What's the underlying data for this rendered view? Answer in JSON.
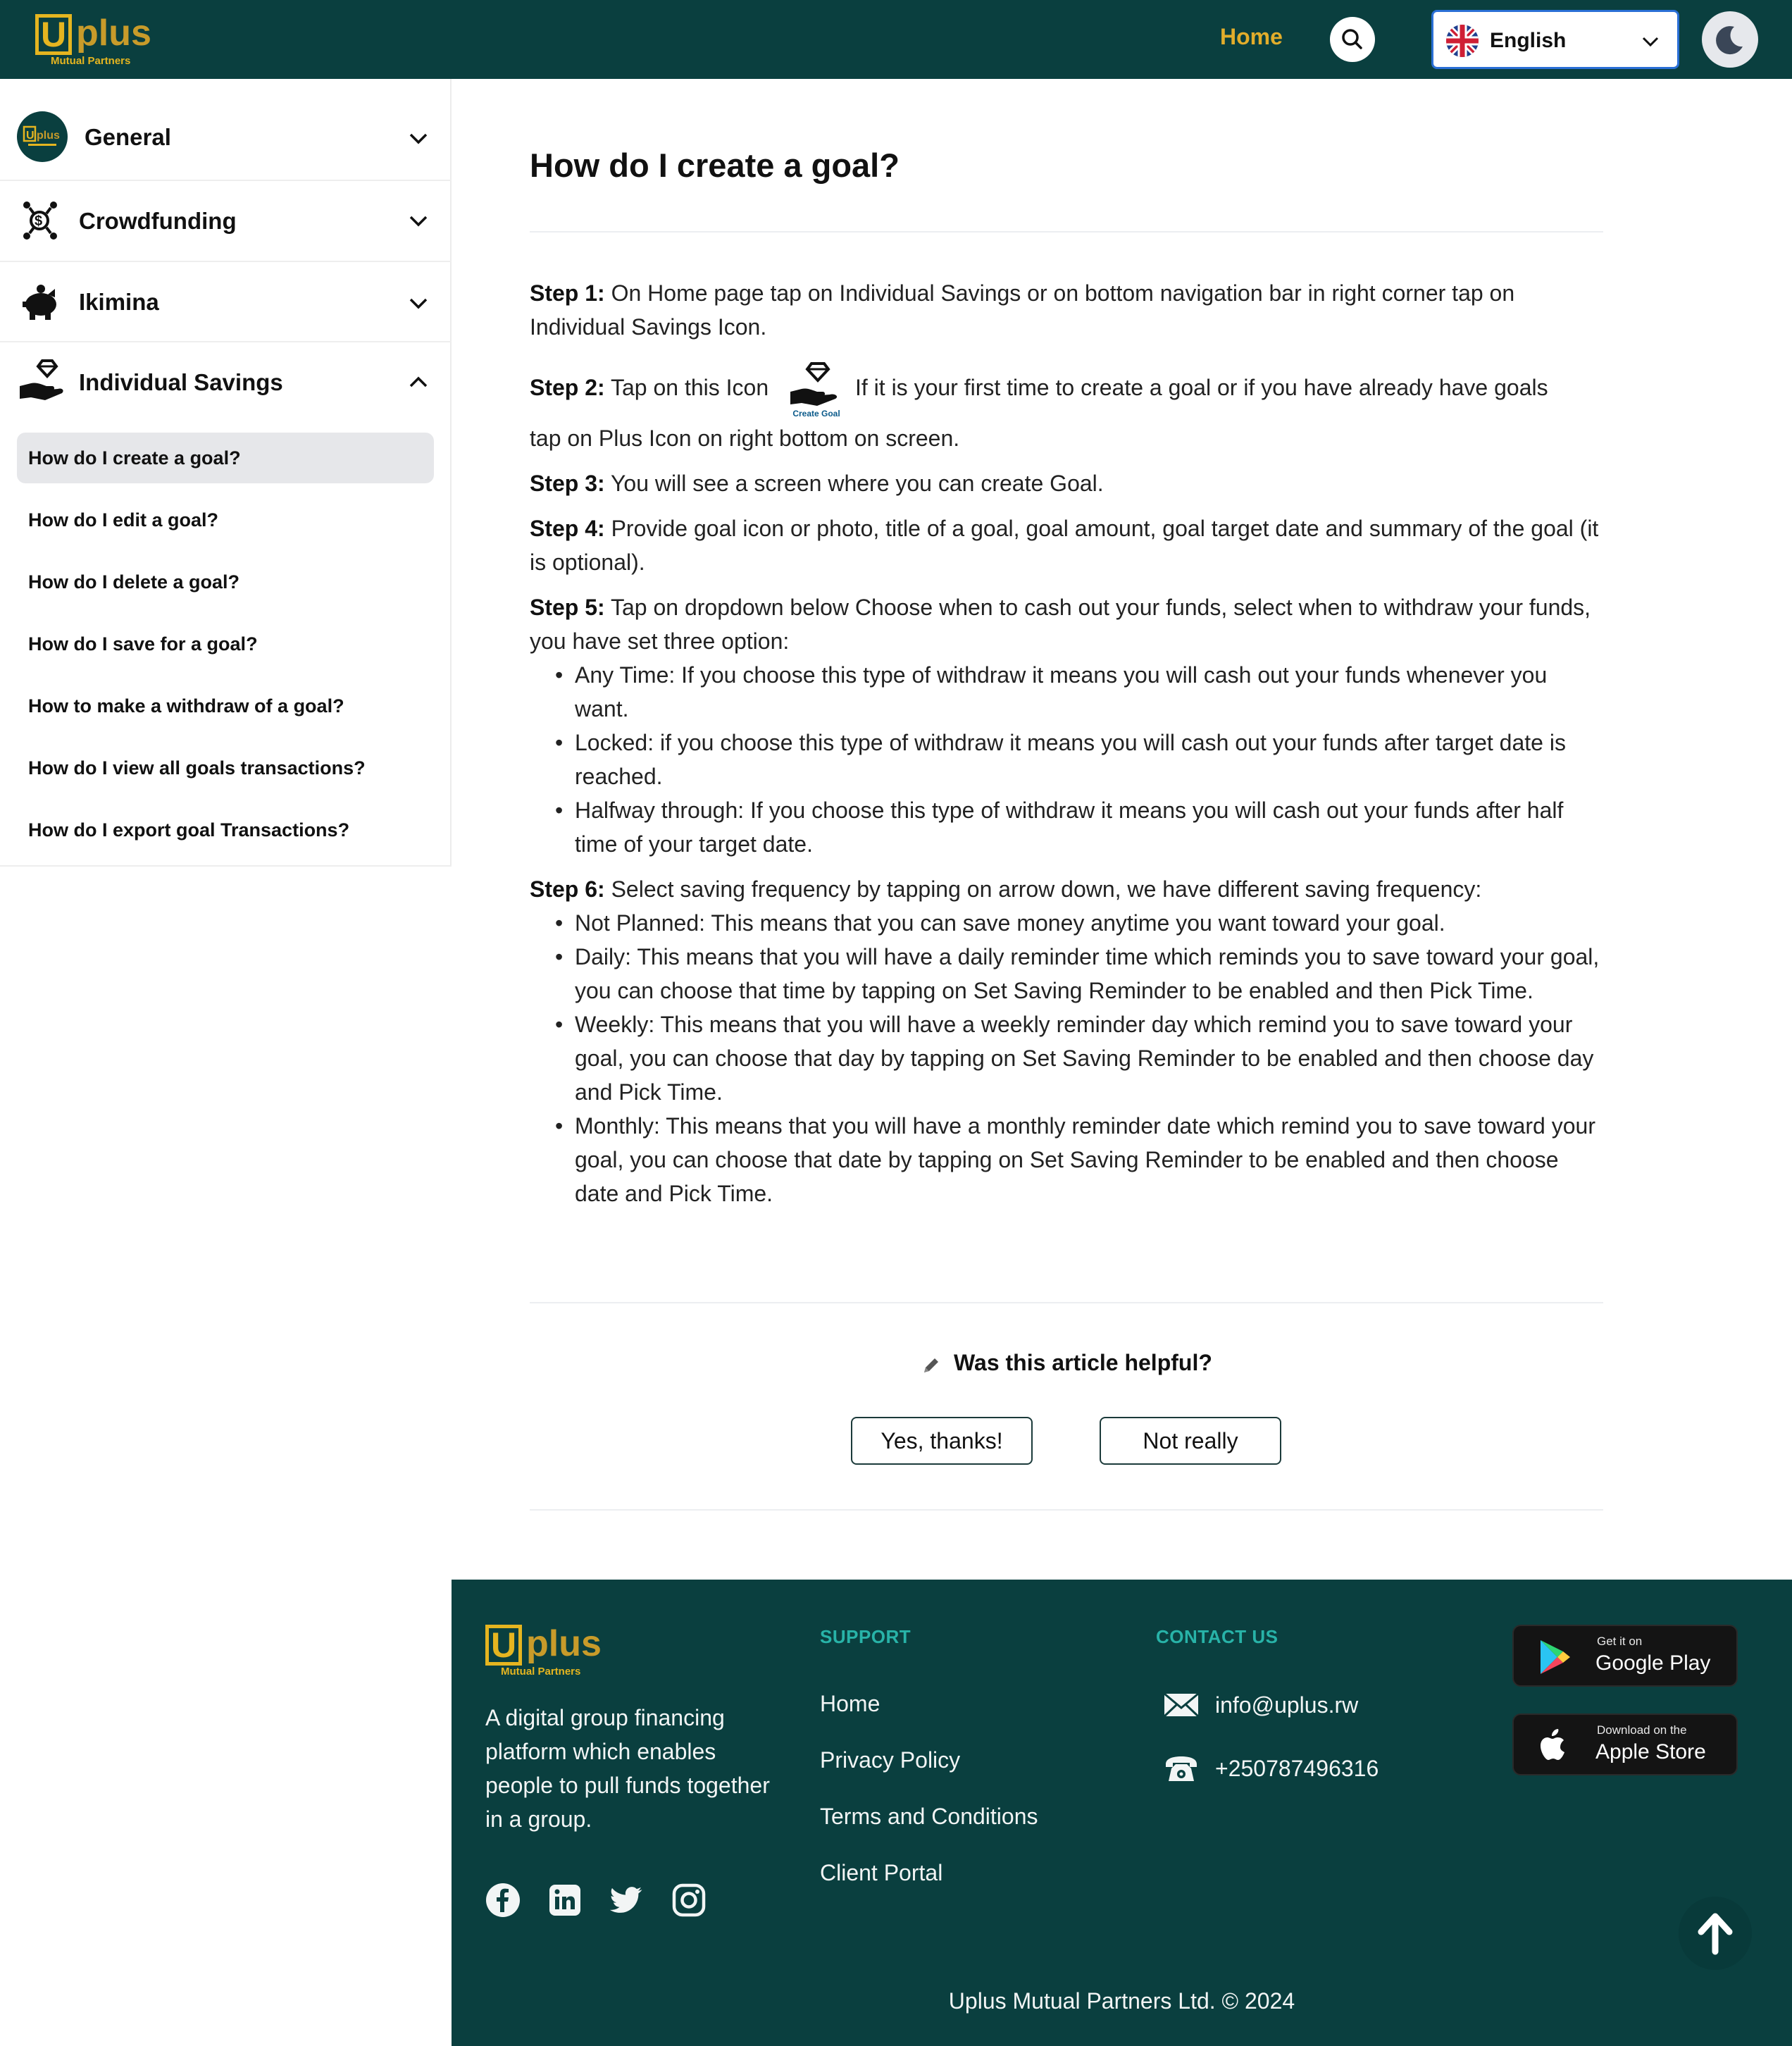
{
  "header": {
    "logo": {
      "main": "plus",
      "letter": "U",
      "sub": "Mutual Partners"
    },
    "nav_home": "Home",
    "language": "English"
  },
  "sidebar": {
    "categories": [
      {
        "label": "General",
        "expanded": false,
        "icon": "uplus-logo-icon"
      },
      {
        "label": "Crowdfunding",
        "expanded": false,
        "icon": "crowdfunding-icon"
      },
      {
        "label": "Ikimina",
        "expanded": false,
        "icon": "piggy-bank-icon"
      },
      {
        "label": "Individual Savings",
        "expanded": true,
        "icon": "savings-hand-icon"
      }
    ],
    "sub_items": [
      "How do I create a goal?",
      "How do I edit a goal?",
      "How do I delete a goal?",
      "How do I save for a goal?",
      "How to make a withdraw of a goal?",
      "How do I view all goals transactions?",
      "How do I export goal Transactions?"
    ],
    "active_index": 0
  },
  "article": {
    "title": "How do I create a goal?",
    "steps": {
      "s1_label": "Step 1:",
      "s1_text": " On Home page tap on Individual Savings or on bottom navigation bar in right corner tap on Individual Savings Icon.",
      "s2_label": "Step 2:",
      "s2_text_a": " Tap on this Icon",
      "s2_icon_caption": "Create Goal",
      "s2_text_b": "If it is your first time to create a goal or if you have already have goals",
      "s2_text_c": "tap on Plus Icon on right bottom on screen.",
      "s3_label": "Step 3:",
      "s3_text": " You will see a screen where you can create Goal.",
      "s4_label": "Step 4:",
      "s4_text": " Provide goal icon or photo, title of a goal, goal amount, goal target date and summary of the goal (it is optional).",
      "s5_label": "Step 5:",
      "s5_text": " Tap on dropdown below Choose when to cash out your funds, select when to withdraw your funds, you have set three option:",
      "s5_bullets": [
        "Any Time: If you choose this type of withdraw it means you will cash out your funds whenever you want.",
        "Locked: if you choose this type of withdraw it means you will cash out your funds after target date is reached.",
        "Halfway through: If you choose this type of withdraw it means you will cash out your funds after half time of your target date."
      ],
      "s6_label": "Step 6:",
      "s6_text": " Select saving frequency by tapping on arrow down, we have different saving frequency:",
      "s6_bullets": [
        "Not Planned: This means that you can save money anytime you want toward your goal.",
        "Daily: This means that you will have a daily reminder time which reminds you to save toward your goal, you can choose that time by tapping on Set Saving Reminder to be enabled and then Pick Time.",
        "Weekly: This means that you will have a weekly reminder day which remind you to save toward your goal, you can choose that day by tapping on Set Saving Reminder to be enabled and then choose day and Pick Time.",
        "Monthly: This means that you will have a monthly reminder date which remind you to save toward your goal, you can choose that date by tapping on Set Saving Reminder to be enabled and then choose date and Pick Time."
      ]
    },
    "feedback": {
      "question": "Was this article helpful?",
      "yes": "Yes, thanks!",
      "no": "Not really"
    }
  },
  "footer": {
    "description": "A digital group financing platform which enables people to pull funds together in a group.",
    "support_heading": "SUPPORT",
    "support_links": [
      "Home",
      "Privacy Policy",
      "Terms and Conditions",
      "Client Portal"
    ],
    "contact_heading": "CONTACT US",
    "email": "info@uplus.rw",
    "phone": "+250787496316",
    "google_play": {
      "small": "Get it on",
      "big": "Google Play"
    },
    "apple_store": {
      "small": "Download on the",
      "big": "Apple Store"
    },
    "copyright": "Uplus Mutual Partners Ltd. © 2024"
  },
  "colors": {
    "brand_dark": "#0a3f3f",
    "brand_gold": "#e2ad2b",
    "support_teal": "#28b3a8"
  }
}
